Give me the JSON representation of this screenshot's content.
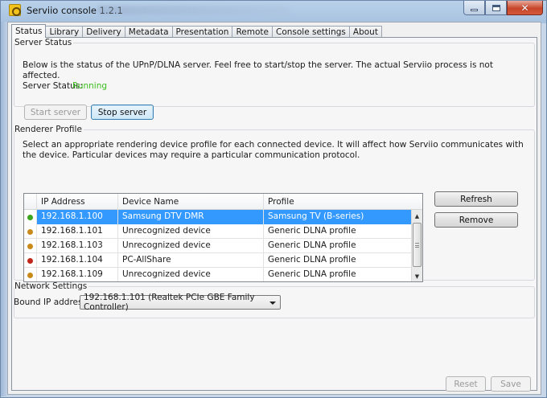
{
  "window": {
    "title": "Serviio console 1.2.1",
    "caption_buttons": {
      "minimize": "minimize",
      "maximize": "maximize",
      "close": "close"
    }
  },
  "tabs": [
    {
      "label": "Status",
      "active": true
    },
    {
      "label": "Library"
    },
    {
      "label": "Delivery"
    },
    {
      "label": "Metadata"
    },
    {
      "label": "Presentation"
    },
    {
      "label": "Remote"
    },
    {
      "label": "Console settings"
    },
    {
      "label": "About"
    }
  ],
  "server_status": {
    "legend": "Server Status",
    "description": "Below is the status of the UPnP/DLNA server. Feel free to start/stop the server. The actual Serviio process is not affected.",
    "status_label": "Server Status:",
    "status_value": "Running",
    "status_color": "#3cbf1e",
    "start_button": "Start server",
    "stop_button": "Stop server"
  },
  "renderer_profile": {
    "legend": "Renderer Profile",
    "description": "Select an appropriate rendering device profile for each connected device. It will affect how Serviio communicates with the device. Particular devices may require a particular communication protocol.",
    "columns": [
      "IP Address",
      "Device Name",
      "Profile"
    ],
    "rows": [
      {
        "status_color": "#3ca61e",
        "ip": "192.168.1.100",
        "device": "Samsung DTV DMR",
        "profile": "Samsung TV (B-series)",
        "selected": true
      },
      {
        "status_color": "#c98a1a",
        "ip": "192.168.1.101",
        "device": "Unrecognized device",
        "profile": "Generic DLNA profile"
      },
      {
        "status_color": "#c98a1a",
        "ip": "192.168.1.103",
        "device": "Unrecognized device",
        "profile": "Generic DLNA profile"
      },
      {
        "status_color": "#c0281c",
        "ip": "192.168.1.104",
        "device": "PC-AllShare",
        "profile": "Generic DLNA profile"
      },
      {
        "status_color": "#c98a1a",
        "ip": "192.168.1.109",
        "device": "Unrecognized device",
        "profile": "Generic DLNA profile"
      }
    ],
    "refresh_button": "Refresh",
    "remove_button": "Remove"
  },
  "network_settings": {
    "legend": "Network Settings",
    "bound_ip_label": "Bound IP address:",
    "bound_ip_value": "192.168.1.101 (Realtek PCIe GBE Family Controller)"
  },
  "footer": {
    "reset_button": "Reset",
    "save_button": "Save"
  }
}
